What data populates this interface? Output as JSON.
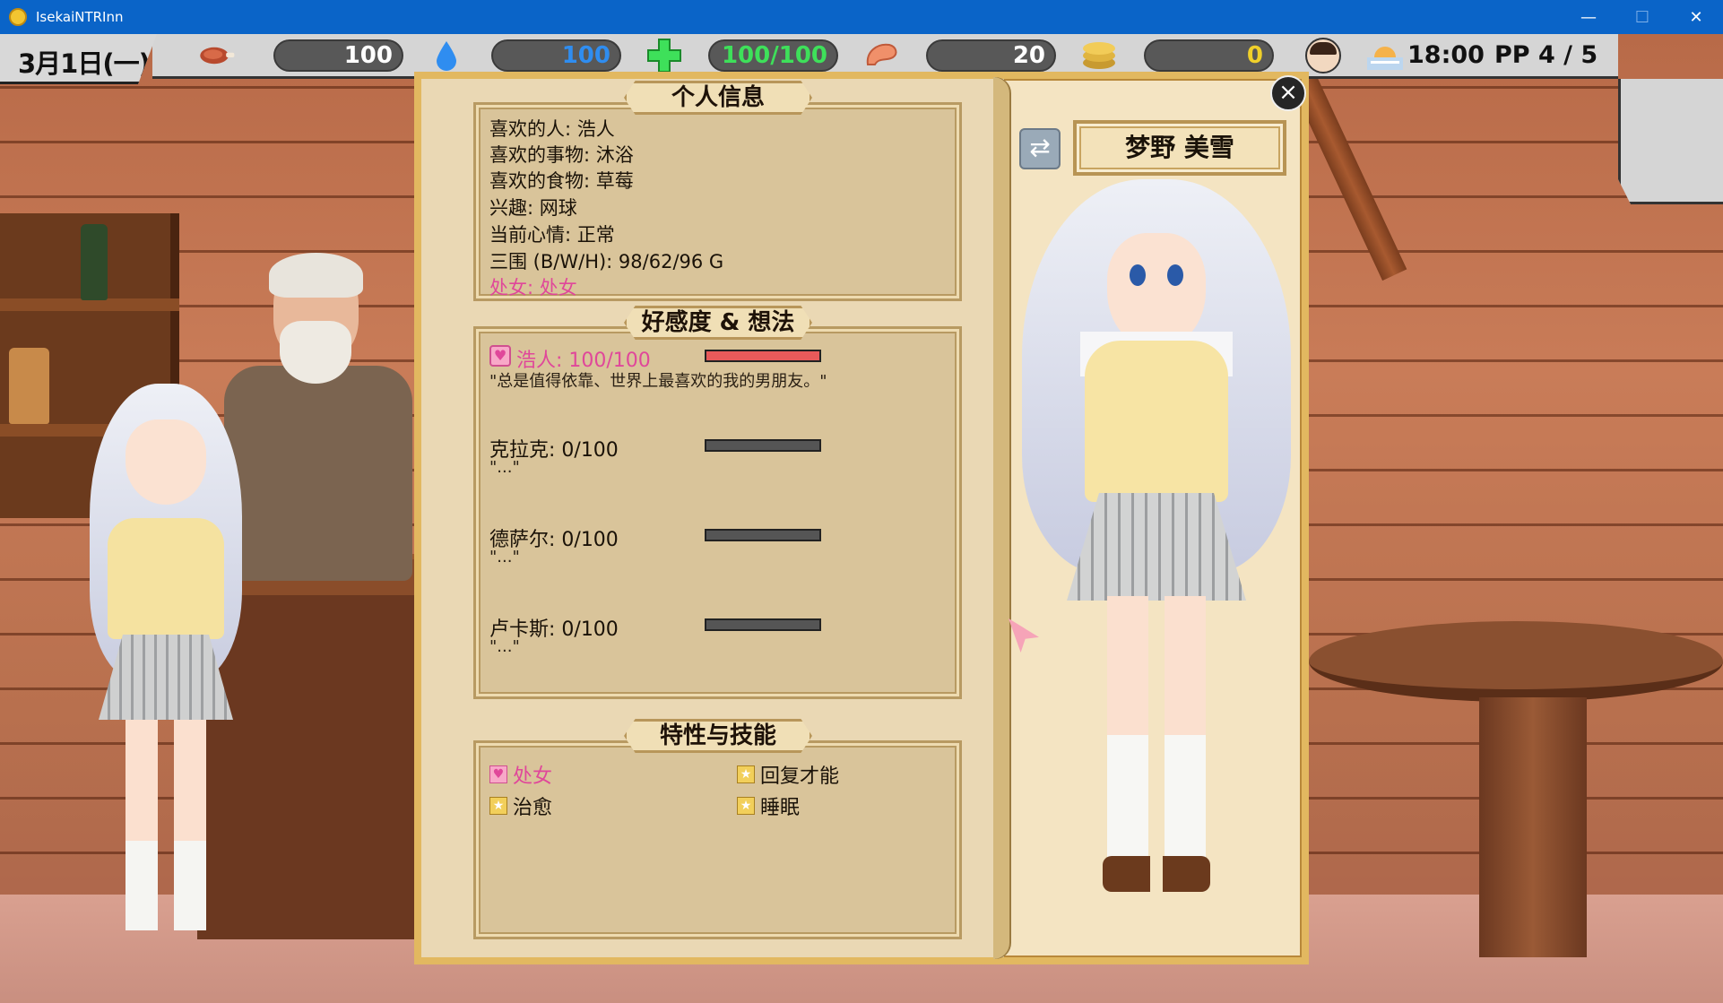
{
  "window": {
    "title": "IsekaiNTRInn",
    "minimize": "—",
    "maximize": "☐",
    "close": "✕"
  },
  "hud": {
    "date": "3月1日(一)",
    "stats": [
      {
        "icon": "meat-icon",
        "value": "100",
        "color": "#ffffff"
      },
      {
        "icon": "water-drop-icon",
        "value": "100",
        "color": "#2f8df0"
      },
      {
        "icon": "health-cross-icon",
        "value": "100/100",
        "color": "#3ee05a"
      },
      {
        "icon": "shrimp-icon",
        "value": "20",
        "color": "#ffffff"
      },
      {
        "icon": "coin-stack-icon",
        "value": "0",
        "color": "#f0d02a"
      }
    ],
    "time": "18:00",
    "pp": "PP 4 / 5"
  },
  "panel": {
    "info_title": "个人信息",
    "info_lines": [
      "喜欢的人: 浩人",
      "喜欢的事物: 沐浴",
      "喜欢的食物: 草莓",
      "兴趣: 网球",
      "当前心情: 正常",
      "三围 (B/W/H): 98/62/96 G"
    ],
    "info_special": "处女: 处女",
    "affection_title": "好感度 & 想法",
    "affection": [
      {
        "name": "浩人: 100/100",
        "quote": "\"总是值得依靠、世界上最喜欢的我的男朋友。\"",
        "level": 1.0
      },
      {
        "name": "克拉克: 0/100",
        "quote": "\"...\"",
        "level": 0.0
      },
      {
        "name": "德萨尔: 0/100",
        "quote": "\"...\"",
        "level": 0.0
      },
      {
        "name": "卢卡斯: 0/100",
        "quote": "\"...\"",
        "level": 0.0
      }
    ],
    "traits_title": "特性与技能",
    "traits": [
      {
        "label": "处女",
        "kind": "heart"
      },
      {
        "label": "回复才能",
        "kind": "star"
      },
      {
        "label": "治愈",
        "kind": "star"
      },
      {
        "label": "睡眠",
        "kind": "star"
      }
    ],
    "character_name": "梦野 美雪",
    "close_label": "×",
    "swap_label": "⇄"
  },
  "colors": {
    "affection_fill": "#e85a5a",
    "highlight_pink": "#e0479a"
  }
}
